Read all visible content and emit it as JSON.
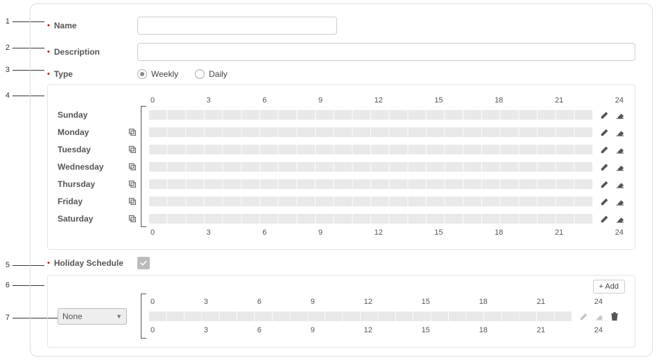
{
  "form": {
    "name_label": "Name",
    "name_value": "",
    "description_label": "Description",
    "description_value": "",
    "type_label": "Type",
    "type_options": {
      "weekly": "Weekly",
      "daily": "Daily"
    },
    "type_selected": "weekly",
    "holiday_label": "Holiday Schedule",
    "holiday_checked": true
  },
  "schedule": {
    "axis": [
      "0",
      "3",
      "6",
      "9",
      "12",
      "15",
      "18",
      "21",
      "24"
    ],
    "days": [
      "Sunday",
      "Monday",
      "Tuesday",
      "Wednesday",
      "Thursday",
      "Friday",
      "Saturday"
    ]
  },
  "holiday": {
    "add_label": "+ Add",
    "select_value": "None",
    "axis": [
      "0",
      "3",
      "6",
      "9",
      "12",
      "15",
      "18",
      "21",
      "24"
    ]
  },
  "callouts": [
    "1",
    "2",
    "3",
    "4",
    "5",
    "6",
    "7"
  ]
}
